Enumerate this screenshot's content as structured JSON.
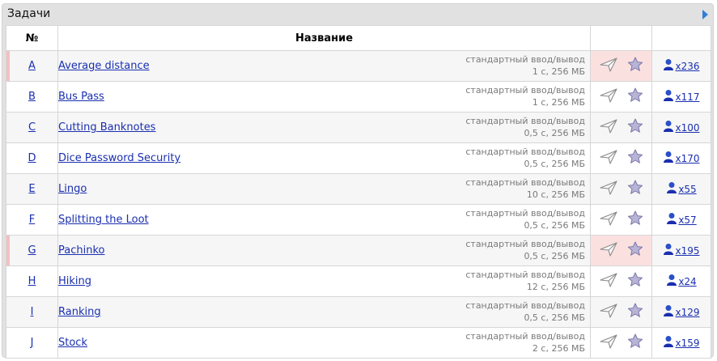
{
  "panel": {
    "title": "Задачи"
  },
  "table": {
    "headers": {
      "num": "№",
      "name": "Название"
    },
    "rows": [
      {
        "letter": "A",
        "name": "Average distance",
        "io": "стандартный ввод/вывод",
        "limits": "1 с, 256 МБ",
        "solved": "x236",
        "highlight": true
      },
      {
        "letter": "B",
        "name": "Bus Pass",
        "io": "стандартный ввод/вывод",
        "limits": "1 с, 256 МБ",
        "solved": "x117",
        "highlight": false
      },
      {
        "letter": "C",
        "name": "Cutting Banknotes",
        "io": "стандартный ввод/вывод",
        "limits": "0,5 с, 256 МБ",
        "solved": "x100",
        "highlight": false
      },
      {
        "letter": "D",
        "name": "Dice Password Security",
        "io": "стандартный ввод/вывод",
        "limits": "0,5 с, 256 МБ",
        "solved": "x170",
        "highlight": false
      },
      {
        "letter": "E",
        "name": "Lingo",
        "io": "стандартный ввод/вывод",
        "limits": "10 с, 256 МБ",
        "solved": "x55",
        "highlight": false
      },
      {
        "letter": "F",
        "name": "Splitting the Loot",
        "io": "стандартный ввод/вывод",
        "limits": "0,5 с, 256 МБ",
        "solved": "x57",
        "highlight": false
      },
      {
        "letter": "G",
        "name": "Pachinko",
        "io": "стандартный ввод/вывод",
        "limits": "0,5 с, 256 МБ",
        "solved": "x195",
        "highlight": true
      },
      {
        "letter": "H",
        "name": "Hiking",
        "io": "стандартный ввод/вывод",
        "limits": "12 с, 256 МБ",
        "solved": "x24",
        "highlight": false
      },
      {
        "letter": "I",
        "name": "Ranking",
        "io": "стандартный ввод/вывод",
        "limits": "0,5 с, 256 МБ",
        "solved": "x129",
        "highlight": false
      },
      {
        "letter": "J",
        "name": "Stock",
        "io": "стандартный ввод/вывод",
        "limits": "2 с, 256 МБ",
        "solved": "x159",
        "highlight": false
      }
    ]
  },
  "icons": {
    "submit": "paper-plane-icon",
    "favorite": "star-icon",
    "user": "user-icon",
    "collapse": "triangle-right-icon"
  },
  "colors": {
    "link": "#1a2fb0",
    "highlight": "#fbe0e0",
    "accent": "#2f7fd4"
  }
}
